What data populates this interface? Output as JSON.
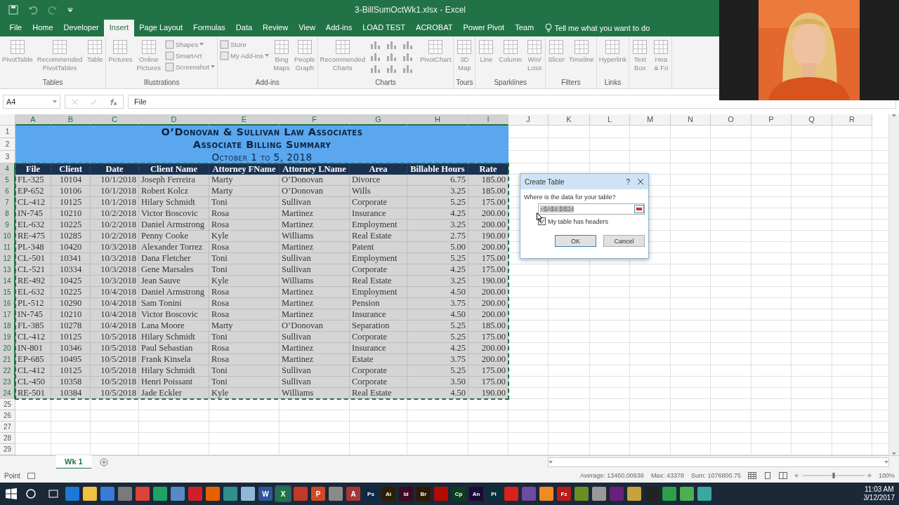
{
  "window": {
    "title": "3-BillSumOctWk1.xlsx  -  Excel"
  },
  "tabs": [
    {
      "label": "File",
      "selected": false
    },
    {
      "label": "Home",
      "selected": false
    },
    {
      "label": "Developer",
      "selected": false
    },
    {
      "label": "Insert",
      "selected": true
    },
    {
      "label": "Page Layout",
      "selected": false
    },
    {
      "label": "Formulas",
      "selected": false
    },
    {
      "label": "Data",
      "selected": false
    },
    {
      "label": "Review",
      "selected": false
    },
    {
      "label": "View",
      "selected": false
    },
    {
      "label": "Add-ins",
      "selected": false
    },
    {
      "label": "LOAD TEST",
      "selected": false
    },
    {
      "label": "ACROBAT",
      "selected": false
    },
    {
      "label": "Power Pivot",
      "selected": false
    },
    {
      "label": "Team",
      "selected": false
    }
  ],
  "tell_me": "Tell me what you want to do",
  "ribbon_groups": [
    {
      "label": "Tables",
      "commands": [
        {
          "kind": "large",
          "label": "PivotTable"
        },
        {
          "kind": "large",
          "label": "Recommended\nPivotTables"
        },
        {
          "kind": "large",
          "label": "Table"
        }
      ]
    },
    {
      "label": "Illustrations",
      "commands": [
        {
          "kind": "large",
          "label": "Pictures"
        },
        {
          "kind": "large",
          "label": "Online\nPictures"
        },
        {
          "kind": "stack",
          "items": [
            {
              "label": "Shapes",
              "dropdown": true
            },
            {
              "label": "SmartArt",
              "dropdown": false
            },
            {
              "label": "Screenshot",
              "dropdown": true
            }
          ]
        }
      ]
    },
    {
      "label": "Add-ins",
      "commands": [
        {
          "kind": "stack",
          "items": [
            {
              "label": "Store",
              "dropdown": false
            },
            {
              "label": "My Add-ins",
              "dropdown": true
            }
          ]
        },
        {
          "kind": "large",
          "label": "Bing\nMaps"
        },
        {
          "kind": "large",
          "label": "People\nGraph"
        }
      ]
    },
    {
      "label": "Charts",
      "commands": [
        {
          "kind": "large",
          "label": "Recommended\nCharts"
        },
        {
          "kind": "chart_grid"
        },
        {
          "kind": "large",
          "label": "PivotChart"
        }
      ]
    },
    {
      "label": "Tours",
      "commands": [
        {
          "kind": "large",
          "label": "3D\nMap"
        }
      ]
    },
    {
      "label": "Sparklines",
      "commands": [
        {
          "kind": "large",
          "label": "Line"
        },
        {
          "kind": "large",
          "label": "Column"
        },
        {
          "kind": "large",
          "label": "Win/\nLoss"
        }
      ]
    },
    {
      "label": "Filters",
      "commands": [
        {
          "kind": "large",
          "label": "Slicer"
        },
        {
          "kind": "large",
          "label": "Timeline"
        }
      ]
    },
    {
      "label": "Links",
      "commands": [
        {
          "kind": "large",
          "label": "Hyperlink"
        }
      ]
    },
    {
      "commands": [
        {
          "kind": "large",
          "label": "Text\nBox"
        },
        {
          "kind": "large",
          "label": "Hea\n& Fo"
        }
      ]
    }
  ],
  "name_box": "A4",
  "formula": "File",
  "columns": [
    {
      "label": "A",
      "selected": true
    },
    {
      "label": "B",
      "selected": true
    },
    {
      "label": "C",
      "selected": true
    },
    {
      "label": "D",
      "selected": true
    },
    {
      "label": "E",
      "selected": true
    },
    {
      "label": "F",
      "selected": true
    },
    {
      "label": "G",
      "selected": true
    },
    {
      "label": "H",
      "selected": true
    },
    {
      "label": "I",
      "selected": true
    },
    {
      "label": "J",
      "selected": false
    },
    {
      "label": "K",
      "selected": false
    },
    {
      "label": "L",
      "selected": false
    },
    {
      "label": "M",
      "selected": false
    },
    {
      "label": "N",
      "selected": false
    },
    {
      "label": "O",
      "selected": false
    },
    {
      "label": "P",
      "selected": false
    },
    {
      "label": "Q",
      "selected": false
    },
    {
      "label": "R",
      "selected": false
    }
  ],
  "row_numbers": [
    {
      "label": "1",
      "selected": false
    },
    {
      "label": "2",
      "selected": false
    },
    {
      "label": "3",
      "selected": false
    },
    {
      "label": "4",
      "selected": true
    },
    {
      "label": "5",
      "selected": true
    },
    {
      "label": "6",
      "selected": true
    },
    {
      "label": "7",
      "selected": true
    },
    {
      "label": "8",
      "selected": true
    },
    {
      "label": "9",
      "selected": true
    },
    {
      "label": "10",
      "selected": true
    },
    {
      "label": "11",
      "selected": true
    },
    {
      "label": "12",
      "selected": true
    },
    {
      "label": "13",
      "selected": true
    },
    {
      "label": "14",
      "selected": true
    },
    {
      "label": "15",
      "selected": true
    },
    {
      "label": "16",
      "selected": true
    },
    {
      "label": "17",
      "selected": true
    },
    {
      "label": "18",
      "selected": true
    },
    {
      "label": "19",
      "selected": true
    },
    {
      "label": "20",
      "selected": true
    },
    {
      "label": "21",
      "selected": true
    },
    {
      "label": "22",
      "selected": true
    },
    {
      "label": "23",
      "selected": true
    },
    {
      "label": "24",
      "selected": true
    },
    {
      "label": "25",
      "selected": false
    },
    {
      "label": "26",
      "selected": false
    },
    {
      "label": "27",
      "selected": false
    },
    {
      "label": "28",
      "selected": false
    },
    {
      "label": "29",
      "selected": false
    }
  ],
  "title_block": [
    "O’Donovan & Sullivan Law Associates",
    "Associate Billing Summary",
    "October 1 to 5, 2018"
  ],
  "header": [
    "File",
    "Client",
    "Date",
    "Client Name",
    "Attorney FName",
    "Attorney LName",
    "Area",
    "Billable Hours",
    "Rate"
  ],
  "rows": [
    [
      "FL-325",
      "10104",
      "10/1/2018",
      "Joseph Ferreira",
      "Marty",
      "O’Donovan",
      "Divorce",
      "6.75",
      "185.00"
    ],
    [
      "EP-652",
      "10106",
      "10/1/2018",
      "Robert Kolcz",
      "Marty",
      "O’Donovan",
      "Wills",
      "3.25",
      "185.00"
    ],
    [
      "CL-412",
      "10125",
      "10/1/2018",
      "Hilary Schmidt",
      "Toni",
      "Sullivan",
      "Corporate",
      "5.25",
      "175.00"
    ],
    [
      "IN-745",
      "10210",
      "10/2/2018",
      "Victor Boscovic",
      "Rosa",
      "Martinez",
      "Insurance",
      "4.25",
      "200.00"
    ],
    [
      "EL-632",
      "10225",
      "10/2/2018",
      "Daniel Armstrong",
      "Rosa",
      "Martinez",
      "Employment",
      "3.25",
      "200.00"
    ],
    [
      "RE-475",
      "10285",
      "10/2/2018",
      "Penny Cooke",
      "Kyle",
      "Williams",
      "Real Estate",
      "2.75",
      "190.00"
    ],
    [
      "PL-348",
      "10420",
      "10/3/2018",
      "Alexander Torrez",
      "Rosa",
      "Martinez",
      "Patent",
      "5.00",
      "200.00"
    ],
    [
      "CL-501",
      "10341",
      "10/3/2018",
      "Dana Fletcher",
      "Toni",
      "Sullivan",
      "Employment",
      "5.25",
      "175.00"
    ],
    [
      "CL-521",
      "10334",
      "10/3/2018",
      "Gene Marsales",
      "Toni",
      "Sullivan",
      "Corporate",
      "4.25",
      "175.00"
    ],
    [
      "RE-492",
      "10425",
      "10/3/2018",
      "Jean Sauve",
      "Kyle",
      "Williams",
      "Real Estate",
      "3.25",
      "190.00"
    ],
    [
      "EL-632",
      "10225",
      "10/4/2018",
      "Daniel Armstrong",
      "Rosa",
      "Martinez",
      "Employment",
      "4.50",
      "200.00"
    ],
    [
      "PL-512",
      "10290",
      "10/4/2018",
      "Sam Tonini",
      "Rosa",
      "Martinez",
      "Pension",
      "3.75",
      "200.00"
    ],
    [
      "IN-745",
      "10210",
      "10/4/2018",
      "Victor Boscovic",
      "Rosa",
      "Martinez",
      "Insurance",
      "4.50",
      "200.00"
    ],
    [
      "FL-385",
      "10278",
      "10/4/2018",
      "Lana Moore",
      "Marty",
      "O’Donovan",
      "Separation",
      "5.25",
      "185.00"
    ],
    [
      "CL-412",
      "10125",
      "10/5/2018",
      "Hilary Schmidt",
      "Toni",
      "Sullivan",
      "Corporate",
      "5.25",
      "175.00"
    ],
    [
      "IN-801",
      "10346",
      "10/5/2018",
      "Paul Sebastian",
      "Rosa",
      "Martinez",
      "Insurance",
      "4.25",
      "200.00"
    ],
    [
      "EP-685",
      "10495",
      "10/5/2018",
      "Frank Kinsela",
      "Rosa",
      "Martinez",
      "Estate",
      "3.75",
      "200.00"
    ],
    [
      "CL-412",
      "10125",
      "10/5/2018",
      "Hilary Schmidt",
      "Toni",
      "Sullivan",
      "Corporate",
      "5.25",
      "175.00"
    ],
    [
      "CL-450",
      "10358",
      "10/5/2018",
      "Henri Poissant",
      "Toni",
      "Sullivan",
      "Corporate",
      "3.50",
      "175.00"
    ],
    [
      "RE-501",
      "10384",
      "10/5/2018",
      "Jade Eckler",
      "Kyle",
      "Williams",
      "Real Estate",
      "4.50",
      "190.00"
    ]
  ],
  "dialog": {
    "title": "Create Table",
    "help": "?",
    "prompt": "Where is the data for your table?",
    "range": "=$A$4:$I$24",
    "has_headers": {
      "label": "My table has headers",
      "checked": true
    },
    "buttons": [
      {
        "label": "OK",
        "kind": "default"
      },
      {
        "label": "Cancel",
        "kind": "normal"
      }
    ]
  },
  "sheet_tabs": [
    {
      "label": "Wk 1",
      "selected": true
    }
  ],
  "status": {
    "mode": "Point",
    "stats": [
      "Average: 13460.00938",
      "Max: 43378",
      "Sum: 1076800.75"
    ],
    "zoom": "100%",
    "zoom_slider": {
      "level": 0.5
    }
  },
  "taskbar": {
    "apps": [
      {
        "color": "#1e78d7",
        "selected": false
      },
      {
        "color": "#f0c040",
        "selected": false
      },
      {
        "color": "#3a7bd5",
        "selected": false
      },
      {
        "color": "#7a7a7a",
        "selected": false
      },
      {
        "color": "#db4437",
        "selected": false
      },
      {
        "color": "#1fa463",
        "selected": false
      },
      {
        "color": "#5a8ac6",
        "selected": false
      },
      {
        "color": "#d01f28",
        "selected": false
      },
      {
        "color": "#e66000",
        "selected": false
      },
      {
        "color": "#2f8f8f",
        "selected": false
      },
      {
        "color": "#8fb8d8",
        "selected": false
      },
      {
        "color": "#2b579a",
        "glyph": "W",
        "selected": false
      },
      {
        "color": "#217346",
        "glyph": "X",
        "selected": true
      },
      {
        "color": "#c0392b",
        "selected": false
      },
      {
        "color": "#d24726",
        "glyph": "P",
        "selected": false
      },
      {
        "color": "#8a8a8a",
        "selected": false
      },
      {
        "color": "#a4373a",
        "glyph": "A",
        "selected": false
      },
      {
        "color": "#0c2a47",
        "glyph": "Ps",
        "selected": false
      },
      {
        "color": "#2d1f06",
        "glyph": "Ai",
        "selected": false
      },
      {
        "color": "#3d0a24",
        "glyph": "Id",
        "selected": false
      },
      {
        "color": "#2d1a02",
        "glyph": "Br",
        "selected": false
      },
      {
        "color": "#b30b00",
        "selected": false
      },
      {
        "color": "#0b3d1e",
        "glyph": "Cp",
        "selected": false
      },
      {
        "color": "#1a0a3a",
        "glyph": "An",
        "selected": false
      },
      {
        "color": "#0a2f3a",
        "glyph": "Pl",
        "selected": false
      },
      {
        "color": "#d7231c",
        "selected": false
      },
      {
        "color": "#6a4ca0",
        "selected": false
      },
      {
        "color": "#f08a24",
        "selected": false
      },
      {
        "color": "#b71c1c",
        "glyph": "Fz",
        "selected": false
      },
      {
        "color": "#6b8e23",
        "selected": false
      },
      {
        "color": "#999999",
        "selected": false
      },
      {
        "color": "#68217a",
        "selected": false
      },
      {
        "color": "#c8a23a",
        "selected": false
      },
      {
        "color": "#222222",
        "selected": false
      },
      {
        "color": "#2e9e4a",
        "selected": false
      },
      {
        "color": "#4caf50",
        "selected": false
      },
      {
        "color": "#3aa7a0",
        "selected": false
      }
    ],
    "time": "11:03 AM",
    "date": "3/12/2017"
  }
}
